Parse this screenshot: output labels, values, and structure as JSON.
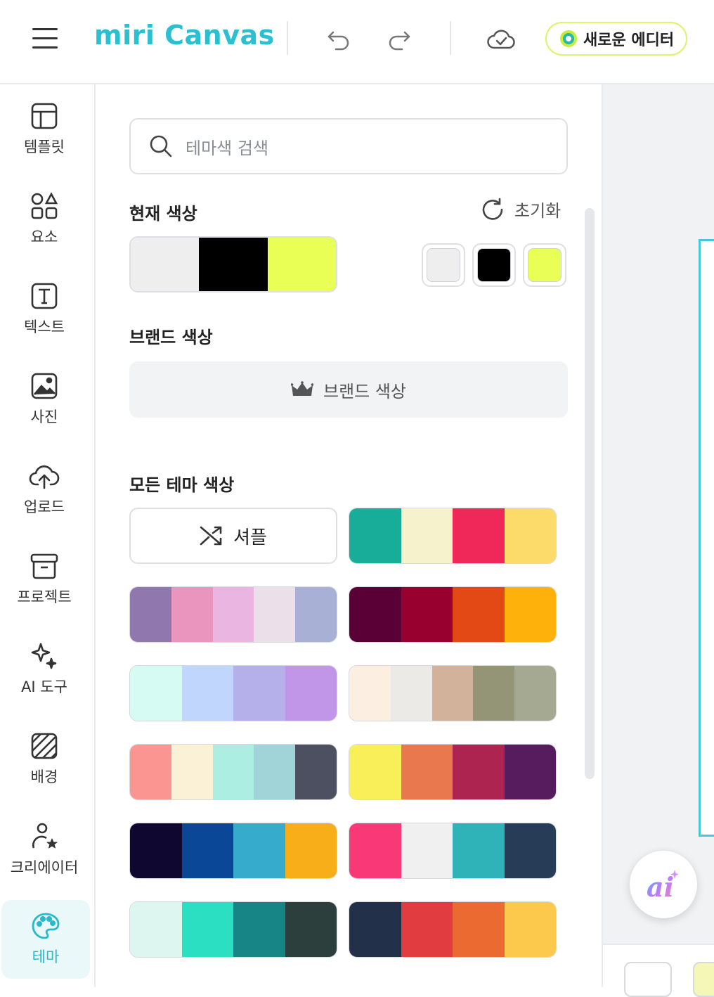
{
  "header": {
    "logo_text": "miri Canvas",
    "editor_button_label": "새로운 에디터"
  },
  "sidebar": {
    "items": [
      {
        "label": "템플릿",
        "icon": "layout-template-icon"
      },
      {
        "label": "요소",
        "icon": "shapes-icon"
      },
      {
        "label": "텍스트",
        "icon": "text-box-icon"
      },
      {
        "label": "사진",
        "icon": "image-icon"
      },
      {
        "label": "업로드",
        "icon": "cloud-upload-icon"
      },
      {
        "label": "프로젝트",
        "icon": "archive-box-icon"
      },
      {
        "label": "AI 도구",
        "icon": "sparkles-icon"
      },
      {
        "label": "배경",
        "icon": "hatch-pattern-icon"
      },
      {
        "label": "크리에이터",
        "icon": "creator-star-icon"
      },
      {
        "label": "테마",
        "icon": "palette-icon"
      }
    ],
    "active_item": "테마"
  },
  "panel": {
    "search_placeholder": "테마색 검색",
    "current_colors_title": "현재 색상",
    "reset_label": "초기화",
    "current_colors": [
      "#eeeeee",
      "#000000",
      "#e9ff55"
    ],
    "brand_colors_title": "브랜드 색상",
    "brand_colors_button": "브랜드 색상",
    "all_themes_title": "모든 테마 색상",
    "shuffle_label": "셔플",
    "palettes": [
      [
        "#17ad98",
        "#f6f2cb",
        "#f0285a",
        "#fddb6a"
      ],
      [
        "#9078ae",
        "#e995bd",
        "#eab5e0",
        "#ebdfea",
        "#a9b0d5"
      ],
      [
        "#5a0037",
        "#97002f",
        "#e24914",
        "#fdb10a"
      ],
      [
        "#d5fbf3",
        "#c0d6fd",
        "#b6b0ea",
        "#c195e7"
      ],
      [
        "#fdeee2",
        "#ebeae6",
        "#d2b29a",
        "#949577",
        "#a6a992"
      ],
      [
        "#fb9591",
        "#fbf1d7",
        "#acefe2",
        "#a1d4d9",
        "#4d5060"
      ],
      [
        "#f8ef59",
        "#ea784f",
        "#ad2450",
        "#561c5d"
      ],
      [
        "#100730",
        "#0b4797",
        "#36abcc",
        "#f7ae19"
      ],
      [
        "#f93878",
        "#f0f0f0",
        "#30b3b8",
        "#273d57"
      ],
      [
        "#ddf6f0",
        "#2bdfc3",
        "#178585",
        "#2d3f3c"
      ],
      [
        "#23304a",
        "#e13c3f",
        "#ea6a31",
        "#fdc94d"
      ]
    ]
  },
  "ai_button_label": "ai"
}
